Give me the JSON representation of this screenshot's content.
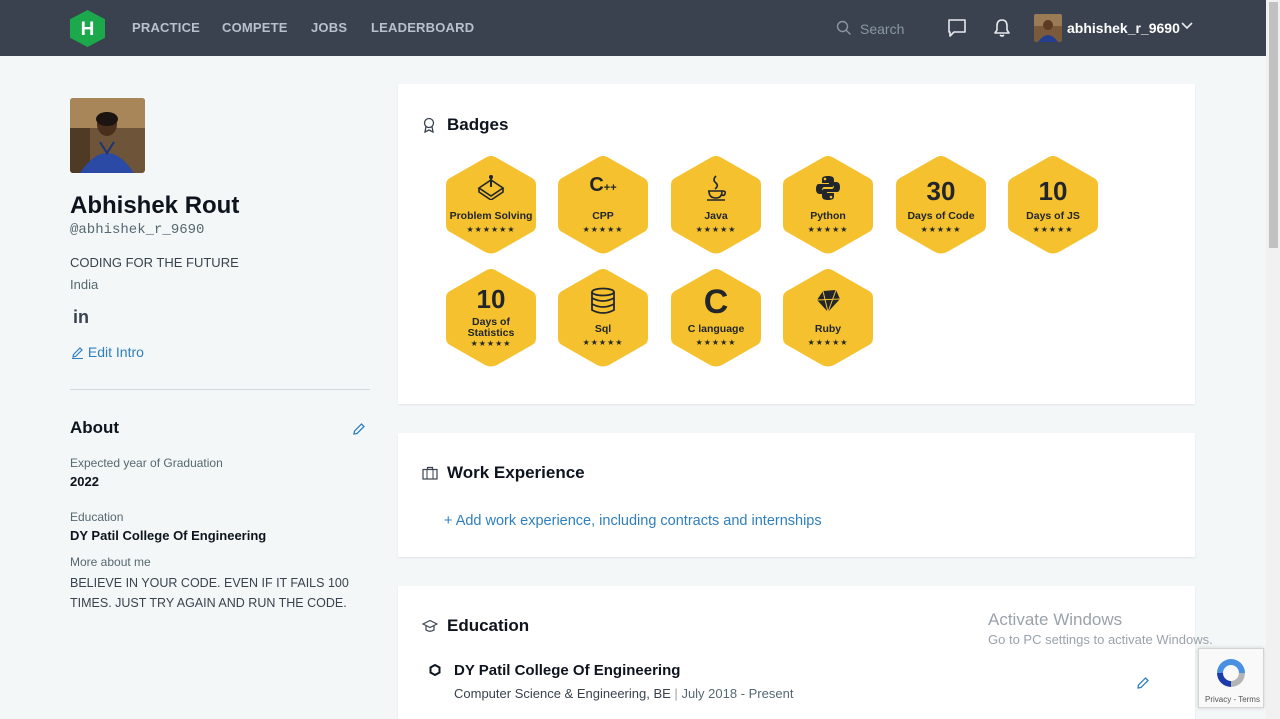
{
  "nav": {
    "logo_letter": "H",
    "links": [
      "PRACTICE",
      "COMPETE",
      "JOBS",
      "LEADERBOARD"
    ],
    "search_placeholder": "Search",
    "username": "abhishek_r_9690"
  },
  "profile": {
    "name": "Abhishek Rout",
    "handle": "@abhishek_r_9690",
    "tagline": "CODING FOR THE FUTURE",
    "country": "India",
    "linkedin": "in",
    "edit_intro": "Edit Intro"
  },
  "about": {
    "title": "About",
    "grad_label": "Expected year of Graduation",
    "grad_value": "2022",
    "edu_label": "Education",
    "edu_value": "DY Patil College Of Engineering",
    "more_label": "More about me",
    "more_value": "BELIEVE IN YOUR CODE. EVEN IF IT FAILS 100 TIMES. JUST TRY AGAIN AND RUN THE CODE."
  },
  "badges": {
    "title": "Badges",
    "items": [
      {
        "label": "Problem Solving",
        "stars": "★★★★★★",
        "icon": "problem-solving-icon"
      },
      {
        "label": "CPP",
        "stars": "★★★★★",
        "icon": "cpp-icon"
      },
      {
        "label": "Java",
        "stars": "★★★★★",
        "icon": "java-icon"
      },
      {
        "label": "Python",
        "stars": "★★★★★",
        "icon": "python-icon"
      },
      {
        "label": "Days of Code",
        "number": "30",
        "stars": "★★★★★",
        "icon": "number"
      },
      {
        "label": "Days of JS",
        "number": "10",
        "stars": "★★★★★",
        "icon": "number"
      },
      {
        "label": "Days of Statistics",
        "number": "10",
        "stars": "★★★★★",
        "icon": "number"
      },
      {
        "label": "Sql",
        "stars": "★★★★★",
        "icon": "sql-icon"
      },
      {
        "label": "C language",
        "stars": "★★★★★",
        "icon": "c-icon"
      },
      {
        "label": "Ruby",
        "stars": "★★★★★",
        "icon": "ruby-icon"
      }
    ]
  },
  "work": {
    "title": "Work Experience",
    "add_link": "+ Add work experience, including contracts and internships"
  },
  "education": {
    "title": "Education",
    "school": "DY Patil College Of Engineering",
    "degree": "Computer Science & Engineering, BE",
    "separator": "|",
    "dates": "July 2018 - Present"
  },
  "watermark": {
    "line1": "Activate Windows",
    "line2": "Go to PC settings to activate Windows."
  },
  "recaptcha": {
    "terms": "Privacy - Terms"
  },
  "colors": {
    "nav_bg": "#39424e",
    "brand_green": "#1ba94c",
    "badge_gold": "#f5c12e",
    "link_blue": "#2f7fbf"
  }
}
